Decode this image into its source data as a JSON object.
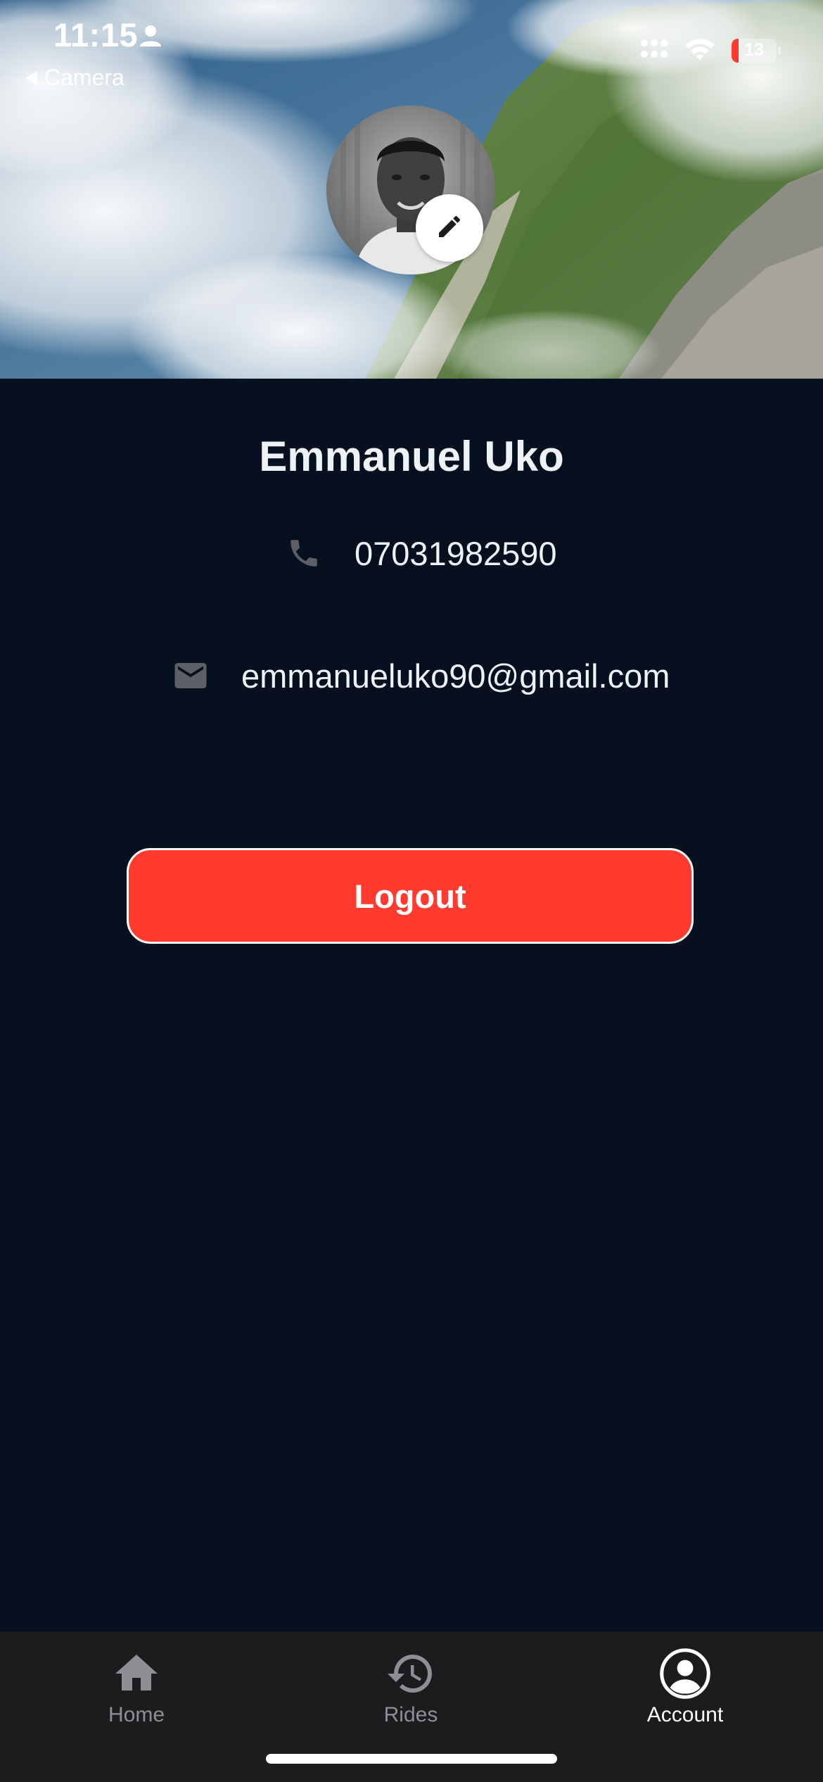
{
  "status_bar": {
    "time": "11:15",
    "back_label": "Camera",
    "battery_level": "13",
    "icons": [
      "person-icon",
      "cellular-icon",
      "wifi-icon",
      "battery-icon"
    ]
  },
  "profile": {
    "name": "Emmanuel Uko",
    "phone": "07031982590",
    "email": "emmanueluko90@gmail.com",
    "avatar_icon": "avatar-photo",
    "edit_icon": "pencil-icon"
  },
  "actions": {
    "logout_label": "Logout"
  },
  "tab_bar": {
    "tabs": [
      {
        "label": "Home",
        "icon": "home-icon",
        "active": false
      },
      {
        "label": "Rides",
        "icon": "history-icon",
        "active": false
      },
      {
        "label": "Account",
        "icon": "account-circle-icon",
        "active": true
      }
    ]
  },
  "colors": {
    "background": "#06101e",
    "logout": "#ff3b30",
    "tab_bar": "#1c1c1e",
    "tab_inactive": "#8e8e93",
    "tab_active": "#ffffff"
  }
}
